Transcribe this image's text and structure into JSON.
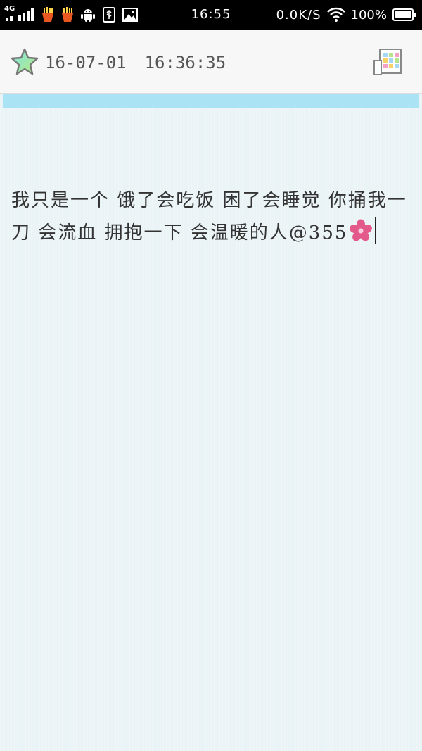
{
  "status_bar": {
    "network_type": "4G",
    "time": "16:55",
    "speed": "0.0K/S",
    "battery": "100%",
    "icons": [
      "signal-icon",
      "fries-icon",
      "fries-icon",
      "android-icon",
      "usb-icon",
      "image-icon",
      "wifi-icon",
      "battery-icon"
    ]
  },
  "header": {
    "date": "16-07-01",
    "time": "16:36:35",
    "left_icon": "star-icon",
    "right_icon": "theme-grid-icon"
  },
  "note": {
    "text": "我只是一个 饿了会吃饭 困了会睡觉 你捅我一刀 会流血 拥抱一下 会温暖的人@355",
    "emoji_icon": "flower-icon"
  },
  "colors": {
    "accent_bar": "#a9e3f4",
    "paper": "#eaf3f5",
    "flower": "#e35a8a"
  }
}
